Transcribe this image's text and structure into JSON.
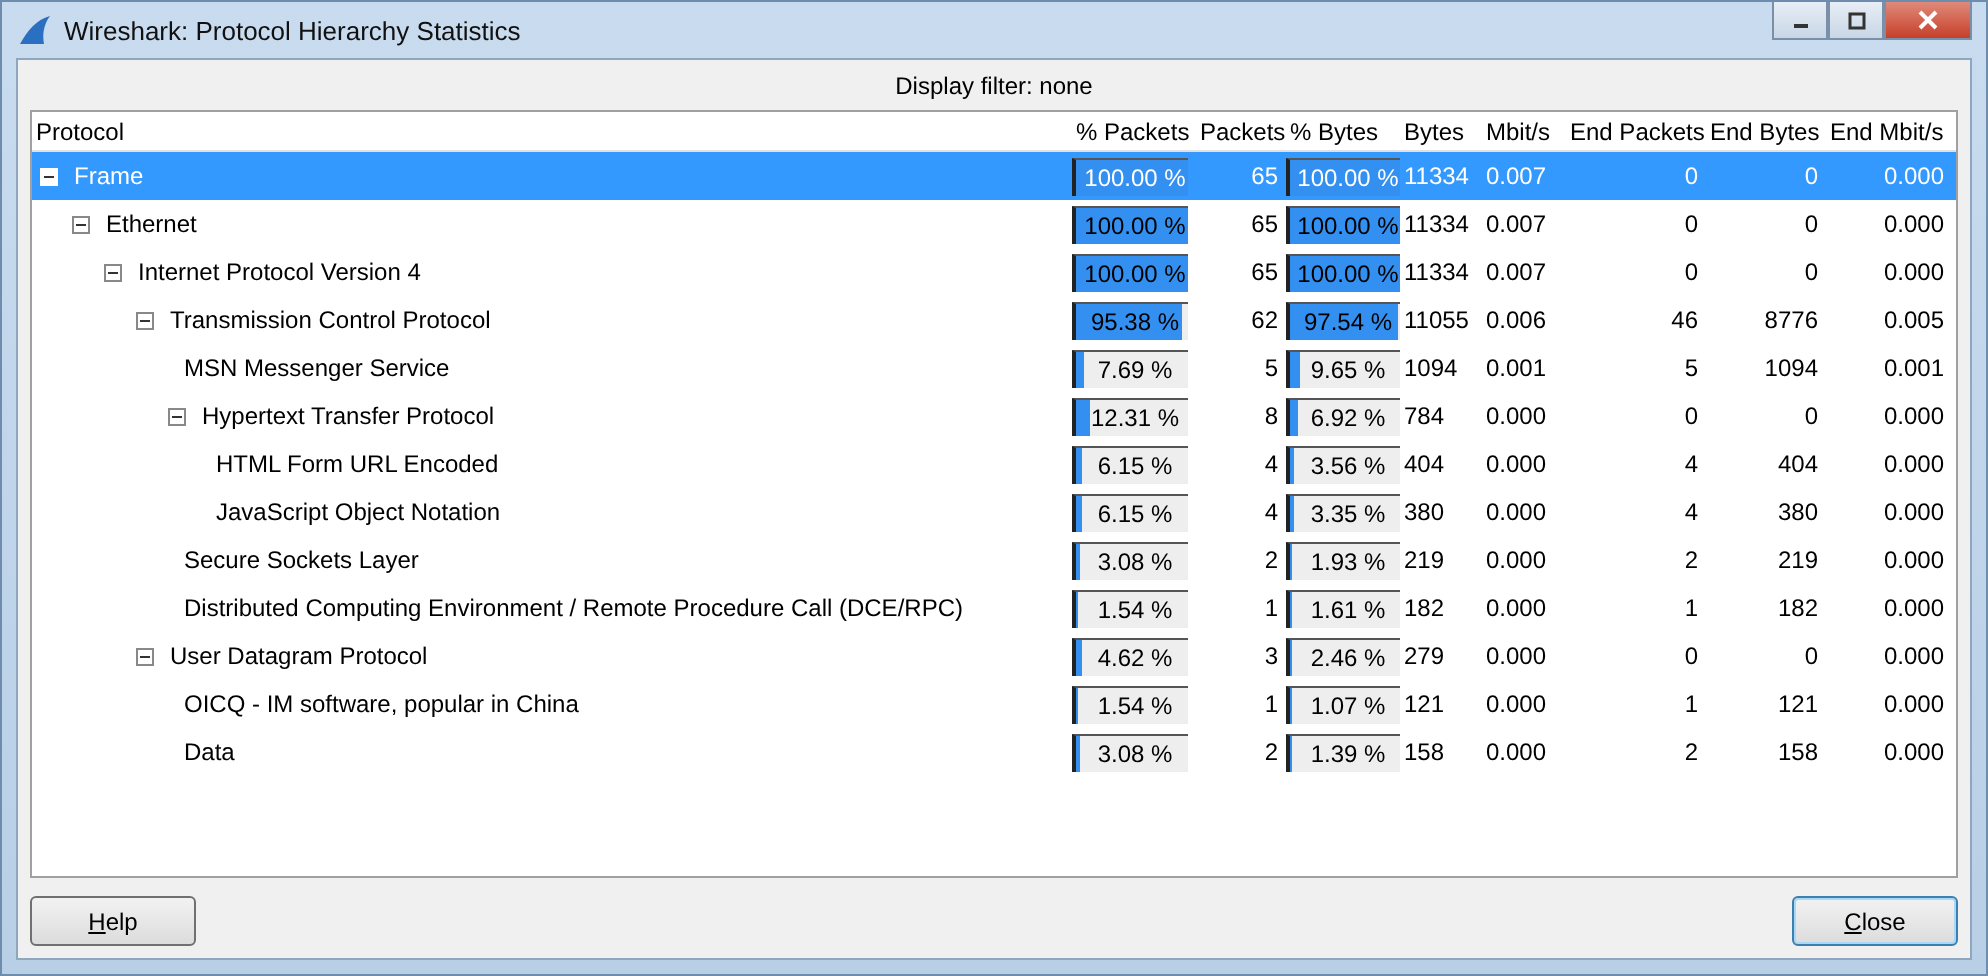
{
  "window": {
    "title": "Wireshark: Protocol Hierarchy Statistics"
  },
  "display_filter": "Display filter: none",
  "columns": [
    "Protocol",
    "% Packets",
    "Packets",
    "% Bytes",
    "Bytes",
    "Mbit/s",
    "End Packets",
    "End Bytes",
    "End Mbit/s"
  ],
  "rows": [
    {
      "protocol": "Frame",
      "selected": true,
      "expanded": true,
      "pct_packets": {
        "text": "100.00 %",
        "level": 1
      },
      "packets": "65",
      "pct_bytes": {
        "text": "100.00 %",
        "level": 1
      },
      "bytes": "11334",
      "mbits": "0.007",
      "end_packets": "0",
      "end_bytes": "0",
      "end_mbits": "0.000",
      "children": [
        {
          "protocol": "Ethernet",
          "selected": false,
          "expanded": true,
          "pct_packets": {
            "text": "100.00 %",
            "level": 1
          },
          "packets": "65",
          "pct_bytes": {
            "text": "100.00 %",
            "level": 1
          },
          "bytes": "11334",
          "mbits": "0.007",
          "end_packets": "0",
          "end_bytes": "0",
          "end_mbits": "0.000",
          "children": [
            {
              "protocol": "Internet Protocol Version 4",
              "selected": false,
              "expanded": true,
              "pct_packets": {
                "text": "100.00 %",
                "level": 1
              },
              "packets": "65",
              "pct_bytes": {
                "text": "100.00 %",
                "level": 1
              },
              "bytes": "11334",
              "mbits": "0.007",
              "end_packets": "0",
              "end_bytes": "0",
              "end_mbits": "0.000",
              "children": [
                {
                  "protocol": "Transmission Control Protocol",
                  "selected": false,
                  "expanded": true,
                  "pct_packets": {
                    "text": "95.38 %",
                    "level": 0.9538
                  },
                  "packets": "62",
                  "pct_bytes": {
                    "text": "97.54 %",
                    "level": 0.9754
                  },
                  "bytes": "11055",
                  "mbits": "0.006",
                  "end_packets": "46",
                  "end_bytes": "8776",
                  "end_mbits": "0.005",
                  "children": [
                    {
                      "protocol": "MSN Messenger Service",
                      "selected": false,
                      "pct_packets": {
                        "text": "7.69 %",
                        "level": 0.0769
                      },
                      "packets": "5",
                      "pct_bytes": {
                        "text": "9.65 %",
                        "level": 0.0965
                      },
                      "bytes": "1094",
                      "mbits": "0.001",
                      "end_packets": "5",
                      "end_bytes": "1094",
                      "end_mbits": "0.001"
                    },
                    {
                      "protocol": "Hypertext Transfer Protocol",
                      "selected": false,
                      "expanded": true,
                      "pct_packets": {
                        "text": "12.31 %",
                        "level": 0.1231
                      },
                      "packets": "8",
                      "pct_bytes": {
                        "text": "6.92 %",
                        "level": 0.0692
                      },
                      "bytes": "784",
                      "mbits": "0.000",
                      "end_packets": "0",
                      "end_bytes": "0",
                      "end_mbits": "0.000",
                      "children": [
                        {
                          "protocol": "HTML Form URL Encoded",
                          "selected": false,
                          "pct_packets": {
                            "text": "6.15 %",
                            "level": 0.0615
                          },
                          "packets": "4",
                          "pct_bytes": {
                            "text": "3.56 %",
                            "level": 0.0356
                          },
                          "bytes": "404",
                          "mbits": "0.000",
                          "end_packets": "4",
                          "end_bytes": "404",
                          "end_mbits": "0.000"
                        },
                        {
                          "protocol": "JavaScript Object Notation",
                          "selected": false,
                          "pct_packets": {
                            "text": "6.15 %",
                            "level": 0.0615
                          },
                          "packets": "4",
                          "pct_bytes": {
                            "text": "3.35 %",
                            "level": 0.0335
                          },
                          "bytes": "380",
                          "mbits": "0.000",
                          "end_packets": "4",
                          "end_bytes": "380",
                          "end_mbits": "0.000"
                        }
                      ]
                    },
                    {
                      "protocol": "Secure Sockets Layer",
                      "selected": false,
                      "pct_packets": {
                        "text": "3.08 %",
                        "level": 0.0308
                      },
                      "packets": "2",
                      "pct_bytes": {
                        "text": "1.93 %",
                        "level": 0.0193
                      },
                      "bytes": "219",
                      "mbits": "0.000",
                      "end_packets": "2",
                      "end_bytes": "219",
                      "end_mbits": "0.000"
                    },
                    {
                      "protocol": "Distributed Computing Environment / Remote Procedure Call (DCE/RPC)",
                      "selected": false,
                      "pct_packets": {
                        "text": "1.54 %",
                        "level": 0.0154
                      },
                      "packets": "1",
                      "pct_bytes": {
                        "text": "1.61 %",
                        "level": 0.0161
                      },
                      "bytes": "182",
                      "mbits": "0.000",
                      "end_packets": "1",
                      "end_bytes": "182",
                      "end_mbits": "0.000"
                    }
                  ]
                },
                {
                  "protocol": "User Datagram Protocol",
                  "selected": false,
                  "expanded": true,
                  "pct_packets": {
                    "text": "4.62 %",
                    "level": 0.0462
                  },
                  "packets": "3",
                  "pct_bytes": {
                    "text": "2.46 %",
                    "level": 0.0246
                  },
                  "bytes": "279",
                  "mbits": "0.000",
                  "end_packets": "0",
                  "end_bytes": "0",
                  "end_mbits": "0.000",
                  "children": [
                    {
                      "protocol": "OICQ - IM software, popular in China",
                      "selected": false,
                      "pct_packets": {
                        "text": "1.54 %",
                        "level": 0.0154
                      },
                      "packets": "1",
                      "pct_bytes": {
                        "text": "1.07 %",
                        "level": 0.0107
                      },
                      "bytes": "121",
                      "mbits": "0.000",
                      "end_packets": "1",
                      "end_bytes": "121",
                      "end_mbits": "0.000"
                    },
                    {
                      "protocol": "Data",
                      "selected": false,
                      "pct_packets": {
                        "text": "3.08 %",
                        "level": 0.0308
                      },
                      "packets": "2",
                      "pct_bytes": {
                        "text": "1.39 %",
                        "level": 0.0139
                      },
                      "bytes": "158",
                      "mbits": "0.000",
                      "end_packets": "2",
                      "end_bytes": "158",
                      "end_mbits": "0.000"
                    }
                  ]
                }
              ]
            }
          ]
        }
      ]
    }
  ],
  "buttons": [
    {
      "label": "Help",
      "kind": "normal"
    },
    {
      "label": "Close",
      "kind": "default"
    }
  ]
}
